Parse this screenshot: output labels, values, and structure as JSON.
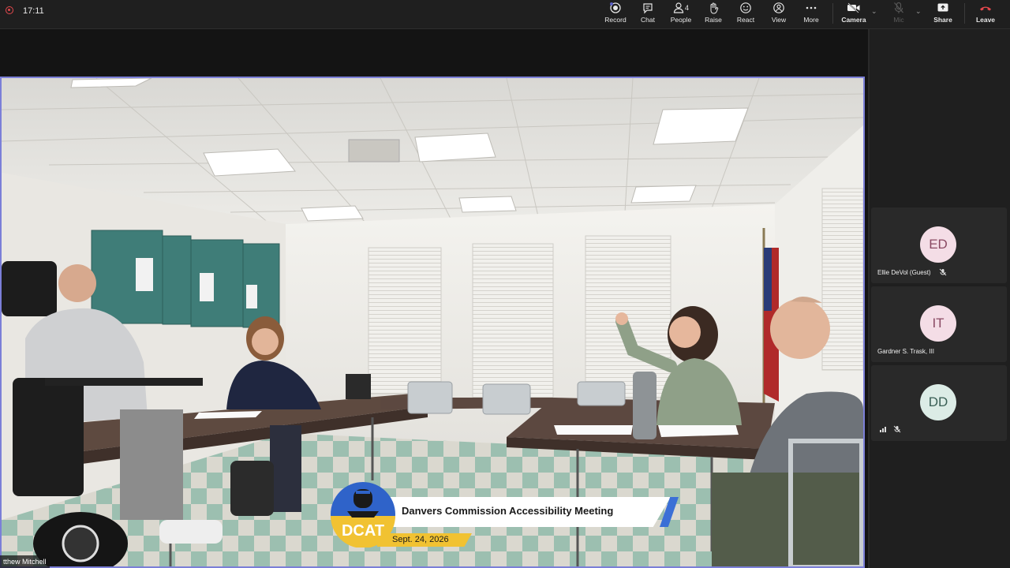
{
  "status": {
    "time": "17:11"
  },
  "toolbar": {
    "record": "Record",
    "chat": "Chat",
    "people": "People",
    "people_count": "4",
    "raise": "Raise",
    "react": "React",
    "view": "View",
    "more": "More",
    "camera": "Camera",
    "mic": "Mic",
    "share": "Share",
    "leave": "Leave"
  },
  "colors": {
    "leave": "#e5484d",
    "accent_border": "#7b7fd8",
    "banner_yellow": "#f1c232",
    "banner_blue": "#3b6fd6"
  },
  "stage": {
    "active_speaker_name": "tthew Mitchell",
    "lower_third": {
      "title": "Danvers Commission Accessibility Meeting",
      "date": "Sept. 24, 2026",
      "logo_text": "DCAT"
    }
  },
  "participants": [
    {
      "initials": "ED",
      "name": "Ellie DeVol (Guest)",
      "muted": true,
      "avatar_color": "#f4dde6"
    },
    {
      "initials": "IT",
      "name": "Gardner S. Trask, III",
      "muted": false,
      "avatar_color": "#f4dde6"
    },
    {
      "initials": "DD",
      "name": "",
      "muted": true,
      "avatar_color": "#dcece6"
    }
  ]
}
